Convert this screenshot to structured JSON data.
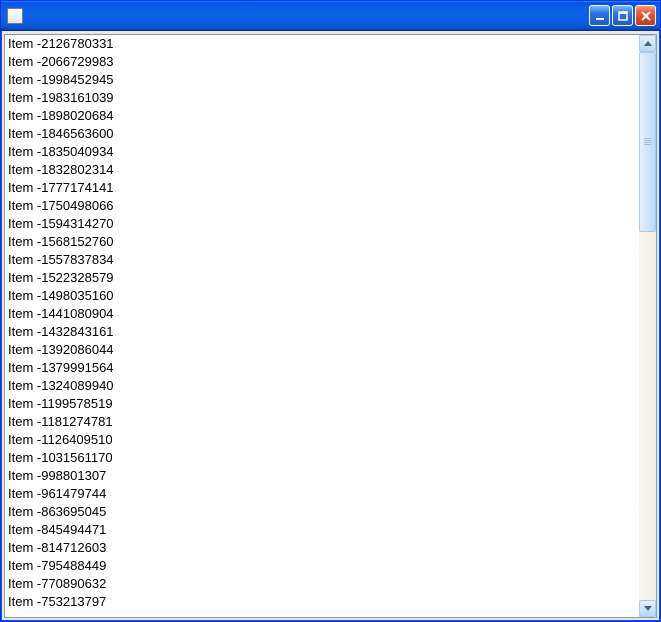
{
  "window": {
    "title": ""
  },
  "list": {
    "items": [
      "Item -2126780331",
      "Item -2066729983",
      "Item -1998452945",
      "Item -1983161039",
      "Item -1898020684",
      "Item -1846563600",
      "Item -1835040934",
      "Item -1832802314",
      "Item -1777174141",
      "Item -1750498066",
      "Item -1594314270",
      "Item -1568152760",
      "Item -1557837834",
      "Item -1522328579",
      "Item -1498035160",
      "Item -1441080904",
      "Item -1432843161",
      "Item -1392086044",
      "Item -1379991564",
      "Item -1324089940",
      "Item -1199578519",
      "Item -1181274781",
      "Item -1126409510",
      "Item -1031561170",
      "Item -998801307",
      "Item -961479744",
      "Item -863695045",
      "Item -845494471",
      "Item -814712603",
      "Item -795488449",
      "Item -770890632",
      "Item -753213797"
    ]
  }
}
